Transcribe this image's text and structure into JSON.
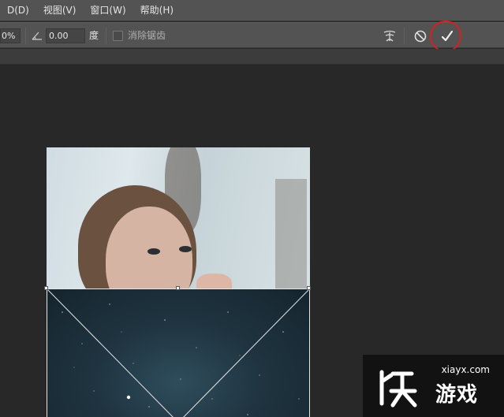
{
  "menubar": {
    "items": [
      {
        "label": "D(D)"
      },
      {
        "label": "视图(V)"
      },
      {
        "label": "窗口(W)"
      },
      {
        "label": "帮助(H)"
      }
    ]
  },
  "options": {
    "percent_value": "0%",
    "angle_value": "0.00",
    "angle_unit": "度",
    "antialias_label": "消除锯齿"
  },
  "watermark": {
    "url": "xiayx.com",
    "brand": "游戏"
  },
  "colors": {
    "panel": "#535353",
    "canvas": "#282828",
    "highlight_circle": "#d42020"
  },
  "icons": {
    "angle": "angle-icon",
    "warp": "warp-mode-icon",
    "cancel": "cancel-transform-icon",
    "commit": "commit-transform-check-icon"
  }
}
